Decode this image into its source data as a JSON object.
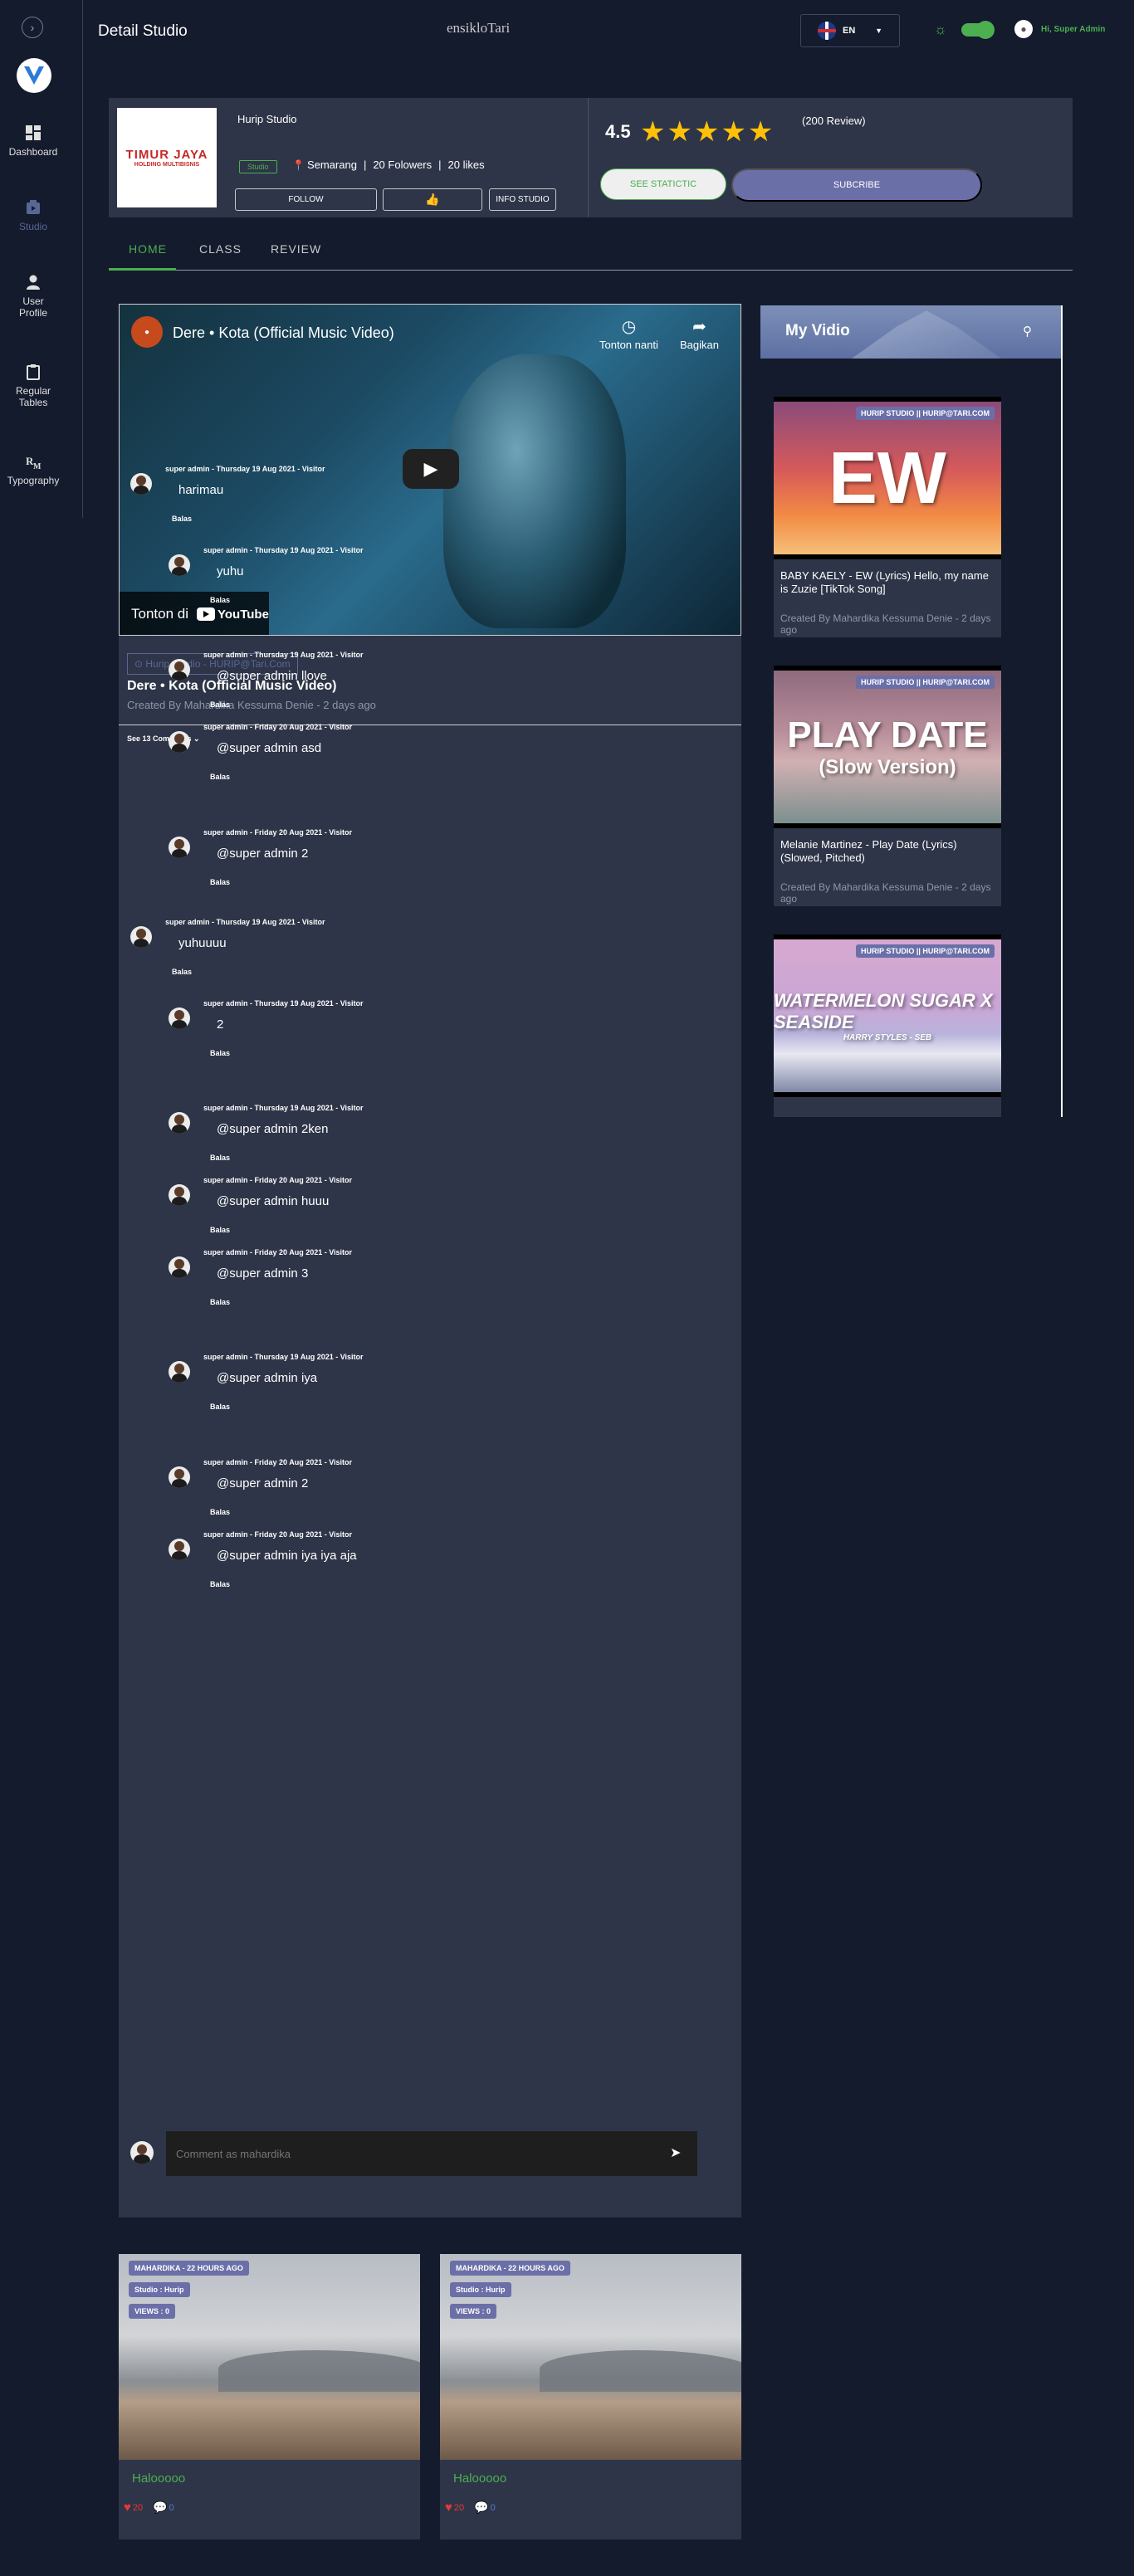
{
  "sidebar": {
    "items": [
      {
        "label": "Dashboard"
      },
      {
        "label": "Studio"
      },
      {
        "label": "User Profile"
      },
      {
        "label": "Regular Tables"
      },
      {
        "label": "Typography"
      }
    ]
  },
  "topbar": {
    "page_title": "Detail Studio",
    "brand": "ensikloTari",
    "language": "EN",
    "user_greeting": "Hi, Super Admin"
  },
  "studio": {
    "name": "Hurip Studio",
    "tag": "Studio",
    "logo_line1": "TIMUR JAYA",
    "logo_line2": "HOLDING MULTIBISNIS",
    "location": "Semarang",
    "followers": "20 Folowers",
    "likes": "20 likes",
    "follow_label": "FOLLOW",
    "like_icon": "👍",
    "info_label": "INFO STUDIO",
    "rating": "4.5",
    "stars": "★★★★★",
    "reviews": "(200 Review)",
    "statistic_label": "SEE STATICTIC",
    "subscribe_label": "SUBCRIBE"
  },
  "tabs": [
    {
      "label": "HOME"
    },
    {
      "label": "CLASS"
    },
    {
      "label": "REVIEW"
    }
  ],
  "video": {
    "title": "Dere • Kota (Official Music Video)",
    "later_label": "Tonton nanti",
    "share_label": "Bagikan",
    "watch_on": "Tonton di",
    "youtube": "YouTube",
    "source": "Hurip Studio - HURIP@Tari.Com",
    "heading": "Dere • Kota (Official Music Video)",
    "meta": "Created By Mahardika Kessuma Denie - 2 days ago"
  },
  "comments": {
    "see_label": "See 13 Comments ⌄",
    "reply_label": "Balas",
    "items": [
      {
        "header": "super admin - Thursday 19 Aug 2021 - Visitor",
        "text": "harimau"
      },
      {
        "header": "super admin - Thursday 19 Aug 2021 - Visitor",
        "text": "yuhu"
      },
      {
        "header": "super admin - Thursday 19 Aug 2021 - Visitor",
        "text": "@super admin llove"
      },
      {
        "header": "super admin - Friday 20 Aug 2021 - Visitor",
        "text": "@super admin asd"
      },
      {
        "header": "super admin - Friday 20 Aug 2021 - Visitor",
        "text": "@super admin 2"
      },
      {
        "header": "super admin - Thursday 19 Aug 2021 - Visitor",
        "text": "yuhuuuu"
      },
      {
        "header": "super admin - Thursday 19 Aug 2021 - Visitor",
        "text": "2"
      },
      {
        "header": "super admin - Thursday 19 Aug 2021 - Visitor",
        "text": "@super admin 2ken"
      },
      {
        "header": "super admin - Friday 20 Aug 2021 - Visitor",
        "text": "@super admin huuu"
      },
      {
        "header": "super admin - Friday 20 Aug 2021 - Visitor",
        "text": "@super admin 3"
      },
      {
        "header": "super admin - Thursday 19 Aug 2021 - Visitor",
        "text": "@super admin iya"
      },
      {
        "header": "super admin - Friday 20 Aug 2021 - Visitor",
        "text": "@super admin 2"
      },
      {
        "header": "super admin - Friday 20 Aug 2021 - Visitor",
        "text": "@super admin iya iya aja"
      }
    ],
    "input_placeholder": "Comment as mahardika"
  },
  "my_video": {
    "title": "My Vidio",
    "items": [
      {
        "badge": "HURIP STUDIO || HURIP@TARI.COM",
        "thumb_text": "EW",
        "thumb_sub": "",
        "title": "BABY KAELY - EW (Lyrics) Hello, my name is Zuzie [TikTok Song]",
        "meta": "Created By Mahardika Kessuma Denie - 2 days ago"
      },
      {
        "badge": "HURIP STUDIO || HURIP@TARI.COM",
        "thumb_text": "PLAY DATE",
        "thumb_sub": "(Slow Version)",
        "title": "Melanie Martinez - Play Date (Lyrics) (Slowed, Pitched)",
        "meta": "Created By Mahardika Kessuma Denie - 2 days ago"
      },
      {
        "badge": "HURIP STUDIO || HURIP@TARI.COM",
        "thumb_text": "WATERMELON SUGAR X SEASIDE",
        "thumb_sub": "HARRY STYLES - SEB",
        "title": "",
        "meta": ""
      }
    ]
  },
  "posts": [
    {
      "author": "MAHARDIKA - 22 HOURS AGO",
      "studio": "Studio : Hurip",
      "views": "VIEWS : 0",
      "title": "Halooooo",
      "likes": "20",
      "comments": "0"
    },
    {
      "author": "MAHARDIKA - 22 HOURS AGO",
      "studio": "Studio : Hurip",
      "views": "VIEWS : 0",
      "title": "Halooooo",
      "likes": "20",
      "comments": "0"
    }
  ],
  "colors": {
    "accent": "#4caf50",
    "primary": "#6b6fa8",
    "background": "#141b2d",
    "panel": "#2e3548"
  }
}
